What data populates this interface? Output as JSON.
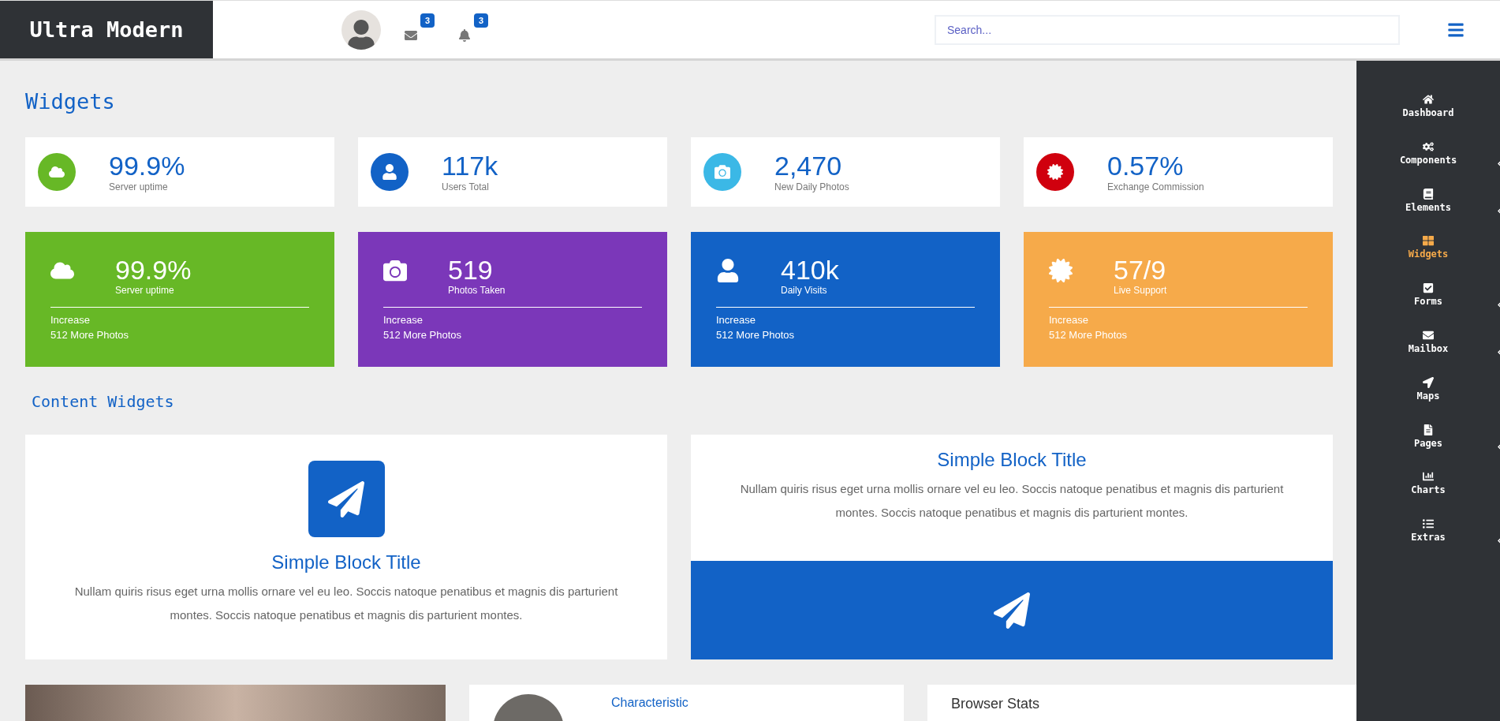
{
  "header": {
    "logo": "Ultra Modern",
    "mail_count": "3",
    "notification_count": "3",
    "search": {
      "placeholder": "Search..."
    }
  },
  "page_title": "Widgets",
  "stats": [
    {
      "value": "99.9%",
      "label": "Server uptime",
      "color": "#67b826"
    },
    {
      "value": "117k",
      "label": "Users Total",
      "color": "#1262c6"
    },
    {
      "value": "2,470",
      "label": "New Daily Photos",
      "color": "#3bb8e6"
    },
    {
      "value": "0.57%",
      "label": "Exchange Commission",
      "color": "#d0000e"
    }
  ],
  "tiles": [
    {
      "value": "99.9%",
      "label": "Server uptime",
      "footer_title": "Increase",
      "footer_text": "512 More Photos",
      "color": "#67b826"
    },
    {
      "value": "519",
      "label": "Photos Taken",
      "footer_title": "Increase",
      "footer_text": "512 More Photos",
      "color": "#7b37b9"
    },
    {
      "value": "410k",
      "label": "Daily Visits",
      "footer_title": "Increase",
      "footer_text": "512 More Photos",
      "color": "#1262c6"
    },
    {
      "value": "57/9",
      "label": "Live Support",
      "footer_title": "Increase",
      "footer_text": "512 More Photos",
      "color": "#f6aa4a"
    }
  ],
  "content_title": "Content Widgets",
  "blocks": [
    {
      "kind": "icon-top",
      "title": "Simple Block Title",
      "text": "Nullam quiris risus eget urna mollis ornare vel eu leo. Soccis natoque penatibus et magnis dis parturient montes. Soccis natoque penatibus et magnis dis parturient montes."
    },
    {
      "kind": "banner-bottom",
      "title": "Simple Block Title",
      "text": "Nullam quiris risus eget urna mollis ornare vel eu leo. Soccis natoque penatibus et magnis dis parturient montes. Soccis natoque penatibus et magnis dis parturient montes."
    }
  ],
  "bottom": {
    "profile_title": "Characteristic",
    "browser_title": "Browser Stats"
  },
  "sidebar": {
    "items": [
      {
        "label": "Dashboard",
        "selected": false,
        "expandable": false
      },
      {
        "label": "Components",
        "selected": false,
        "expandable": true
      },
      {
        "label": "Elements",
        "selected": false,
        "expandable": true
      },
      {
        "label": "Widgets",
        "selected": true,
        "expandable": false
      },
      {
        "label": "Forms",
        "selected": false,
        "expandable": true
      },
      {
        "label": "Mailbox",
        "selected": false,
        "expandable": true
      },
      {
        "label": "Maps",
        "selected": false,
        "expandable": false
      },
      {
        "label": "Pages",
        "selected": false,
        "expandable": true
      },
      {
        "label": "Charts",
        "selected": false,
        "expandable": false
      },
      {
        "label": "Extras",
        "selected": false,
        "expandable": true
      }
    ]
  }
}
